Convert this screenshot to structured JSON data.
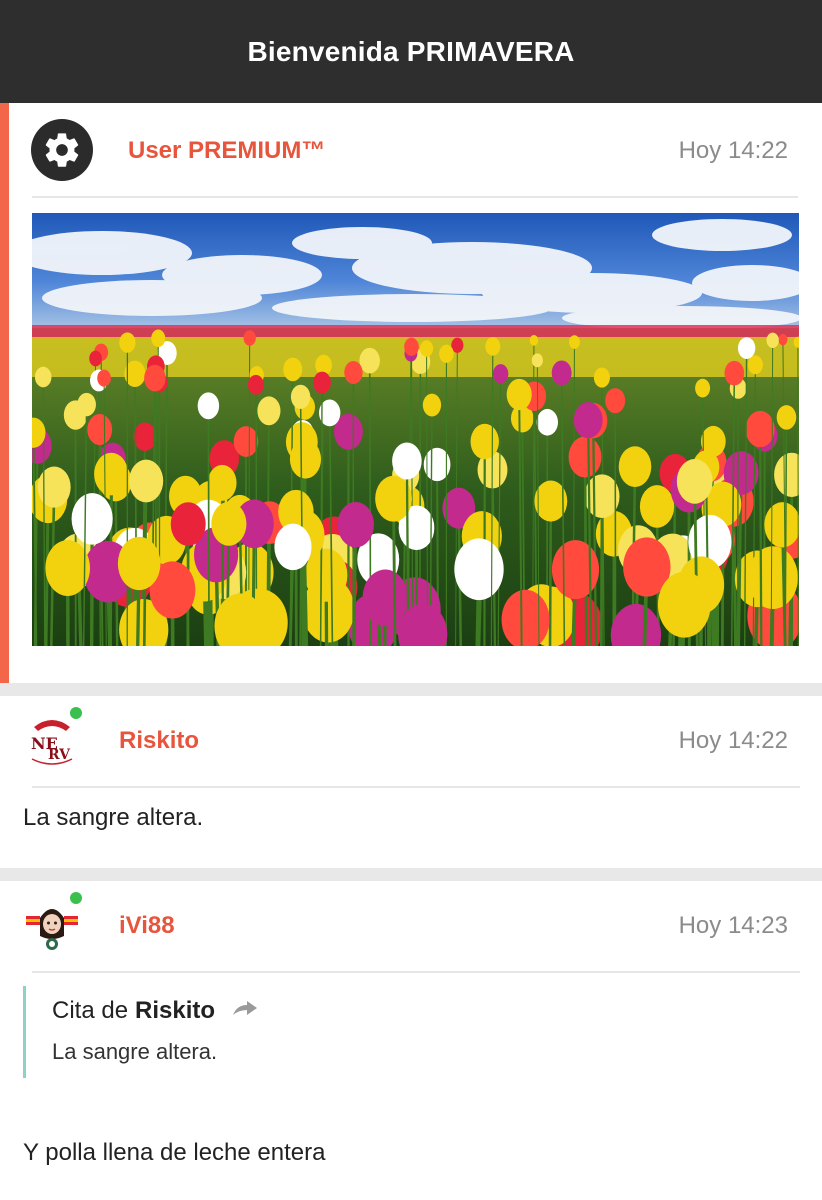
{
  "header": {
    "title": "Bienvenida PRIMAVERA"
  },
  "posts": [
    {
      "user": "User PREMIUM™",
      "time": "Hoy 14:22",
      "avatar_icon": "gear-icon",
      "image": "tulip-field-photo"
    },
    {
      "user": "Riskito",
      "time": "Hoy 14:22",
      "online": true,
      "text": "La sangre altera."
    },
    {
      "user": "iVi88",
      "time": "Hoy 14:23",
      "online": true,
      "quote": {
        "prefix": "Cita de",
        "author": "Riskito",
        "text": "La sangre altera."
      },
      "text": "Y polla llena de leche entera"
    }
  ],
  "colors": {
    "accent": "#f4664a",
    "username": "#e8553d",
    "online": "#3cc04d",
    "quote_border": "#8fd0c7",
    "topbar": "#2e2e2e"
  }
}
